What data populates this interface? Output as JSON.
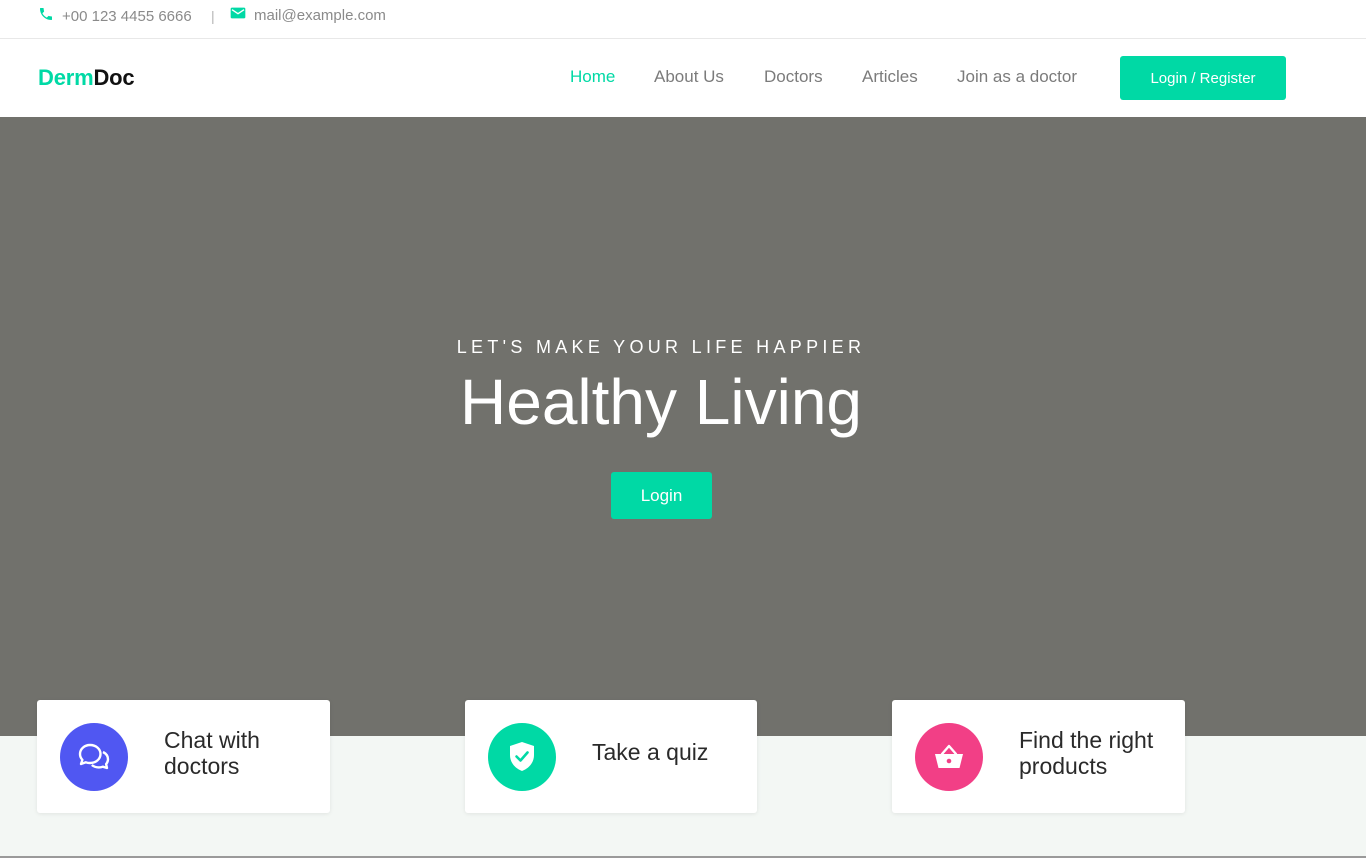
{
  "topbar": {
    "phone": "+00 123 4455 6666",
    "separator": "|",
    "email": "mail@example.com",
    "phone_icon": "phone-icon",
    "mail_icon": "mail-icon"
  },
  "brand": {
    "part1": "Derm",
    "part2": "Doc"
  },
  "nav": {
    "items": [
      "Home",
      "About Us",
      "Doctors",
      "Articles",
      "Join as a doctor"
    ],
    "active": "Home",
    "cta": "Login / Register"
  },
  "hero": {
    "kicker": "LET'S MAKE YOUR LIFE HAPPIER",
    "headline": "Healthy Living",
    "button": "Login"
  },
  "features": [
    {
      "label": "Chat with doctors",
      "line1": "Chat with",
      "line2": "doctors",
      "icon": "chat-icon",
      "color": "#5057f2"
    },
    {
      "label": "Take a quiz",
      "icon": "shield-check-icon",
      "color": "#00d9a5"
    },
    {
      "label": "Find the right products",
      "line1": "Find the right",
      "line2": "products",
      "icon": "basket-icon",
      "color": "#f23f86"
    }
  ],
  "colors": {
    "accent": "#00d9a5",
    "hero_bg": "#71716c",
    "text_muted": "#7b7b7b"
  }
}
